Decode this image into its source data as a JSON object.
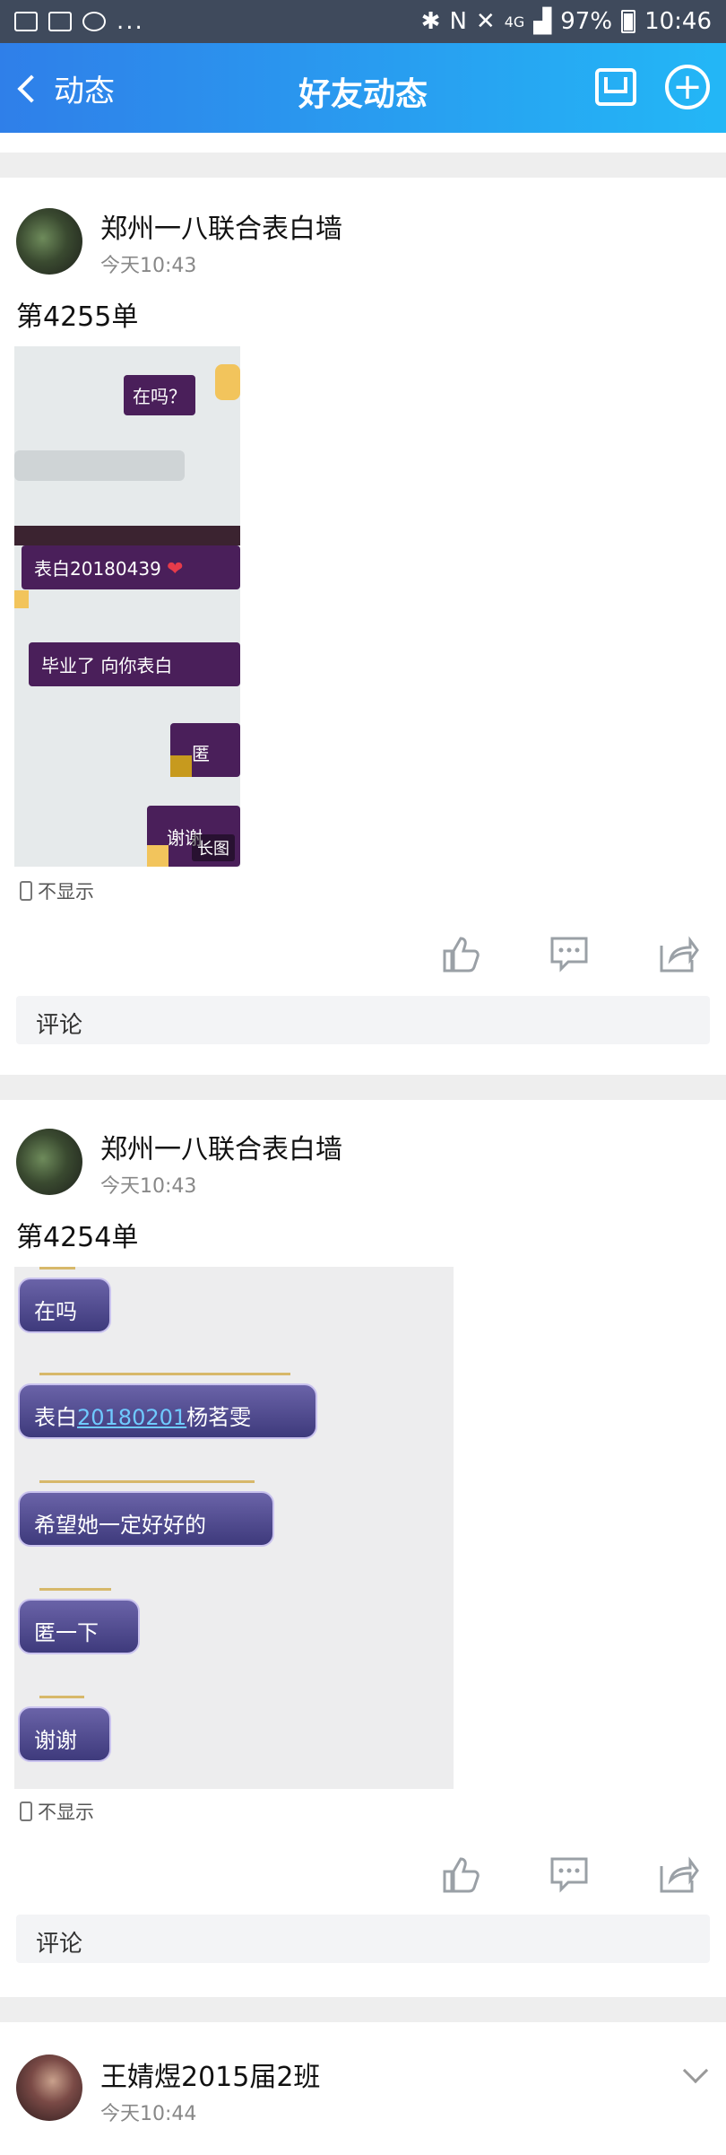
{
  "status_bar": {
    "battery": "97%",
    "time": "10:46",
    "network": "4G",
    "dots": "..."
  },
  "header": {
    "back_label": "动态",
    "title": "好友动态",
    "mail_icon": "mail-icon",
    "add_icon": "plus-circle-icon"
  },
  "posts": [
    {
      "author": "郑州一八联合表白墙",
      "time": "今天10:43",
      "text": "第4255单",
      "image": {
        "bubbles": [
          "在吗？",
          "表白20180439",
          "毕业了 向你表白",
          "匿",
          "谢谢"
        ],
        "tag": "长图"
      },
      "visibility": "不显示",
      "comment_placeholder": "评论"
    },
    {
      "author": "郑州一八联合表白墙",
      "time": "今天10:43",
      "text": "第4254单",
      "image": {
        "bubbles": [
          "在吗",
          "表白",
          "20180201",
          "杨茗雯",
          "希望她一定好好的",
          "匿一下",
          "谢谢"
        ]
      },
      "visibility": "不显示",
      "comment_placeholder": "评论"
    },
    {
      "author": "王婧煜2015届2班",
      "time": "今天10:44"
    }
  ],
  "actions": {
    "like_icon": "thumbs-up-icon",
    "comment_icon": "comment-icon",
    "share_icon": "share-icon"
  }
}
